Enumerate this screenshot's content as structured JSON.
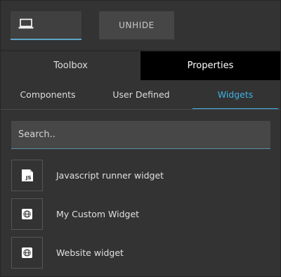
{
  "toolbar": {
    "device_icon": "laptop-icon",
    "unhide_label": "UNHIDE"
  },
  "main_tabs": [
    {
      "label": "Toolbox",
      "active": false
    },
    {
      "label": "Properties",
      "active": true
    }
  ],
  "sub_tabs": [
    {
      "label": "Components",
      "active": false
    },
    {
      "label": "User Defined",
      "active": false
    },
    {
      "label": "Widgets",
      "active": true
    }
  ],
  "search": {
    "placeholder": "Search..",
    "value": ""
  },
  "widgets": [
    {
      "label": "Javascript runner widget",
      "icon": "js-file-icon",
      "icon_text": "JS"
    },
    {
      "label": "My Custom Widget",
      "icon": "globe-icon"
    },
    {
      "label": "Website widget",
      "icon": "globe-icon"
    }
  ],
  "colors": {
    "background": "#333333",
    "accent": "#3fb2e6",
    "active_tab_bg": "#000000",
    "button_bg": "#464646",
    "search_bg": "#474747"
  }
}
